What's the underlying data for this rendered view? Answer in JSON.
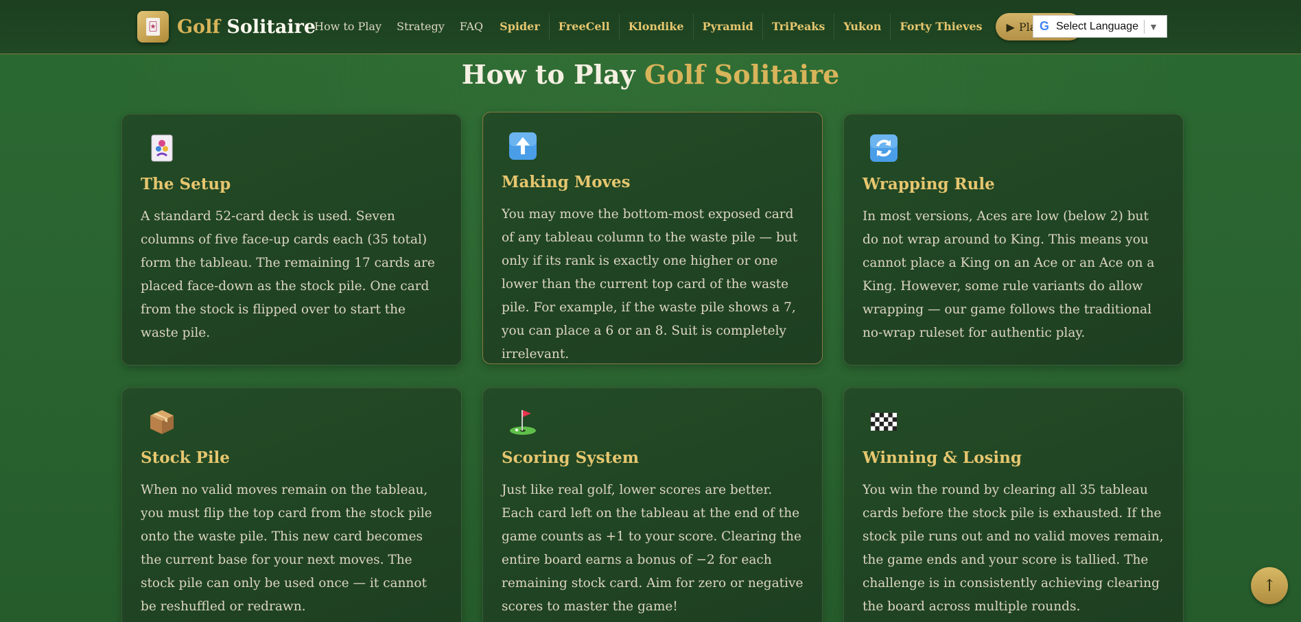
{
  "header": {
    "logo_gold": "Golf",
    "logo_white": "Solitaire",
    "logo_card_glyph": "🃏",
    "nav": [
      "How to Play",
      "Strategy",
      "FAQ"
    ],
    "games": [
      "Spider",
      "FreeCell",
      "Klondike",
      "Pyramid",
      "TriPeaks",
      "Yukon",
      "Forty Thieves"
    ],
    "play_label": "Play Free",
    "play_icon": "▶",
    "language_label": "Select Language",
    "language_arrow": "▼",
    "google_glyph": "G"
  },
  "page": {
    "title_white": "How to Play",
    "title_gold": "Golf Solitaire"
  },
  "cards": [
    {
      "icon": "joker-card-icon",
      "title": "The Setup",
      "body": "A standard 52-card deck is used. Seven columns of five face-up cards each (35 total) form the tableau. The remaining 17 cards are placed face-down as the stock pile. One card from the stock is flipped over to start the waste pile."
    },
    {
      "icon": "up-arrow-icon",
      "title": "Making Moves",
      "body": "You may move the bottom-most exposed card of any tableau column to the waste pile — but only if its rank is exactly one higher or one lower than the current top card of the waste pile. For example, if the waste pile shows a 7, you can place a 6 or an 8. Suit is completely irrelevant."
    },
    {
      "icon": "refresh-icon",
      "title": "Wrapping Rule",
      "body": "In most versions, Aces are low (below 2) but do not wrap around to King. This means you cannot place a King on an Ace or an Ace on a King. However, some rule variants do allow wrapping — our game follows the traditional no-wrap ruleset for authentic play."
    },
    {
      "icon": "package-icon",
      "title": "Stock Pile",
      "body": "When no valid moves remain on the tableau, you must flip the top card from the stock pile onto the waste pile. This new card becomes the current base for your next moves. The stock pile can only be used once — it cannot be reshuffled or redrawn."
    },
    {
      "icon": "golf-flag-icon",
      "title": "Scoring System",
      "body": "Just like real golf, lower scores are better. Each card left on the tableau at the end of the game counts as +1 to your score. Clearing the entire board earns a bonus of −2 for each remaining stock card. Aim for zero or negative scores to master the game!"
    },
    {
      "icon": "checkered-flag-icon",
      "title": "Winning & Losing",
      "body": "You win the round by clearing all 35 tableau cards before the stock pile is exhausted. If the stock pile runs out and no valid moves remain, the game ends and your score is tallied. The challenge is in consistently achieving clearing the board across multiple rounds."
    }
  ],
  "scroll_top_glyph": "↑"
}
